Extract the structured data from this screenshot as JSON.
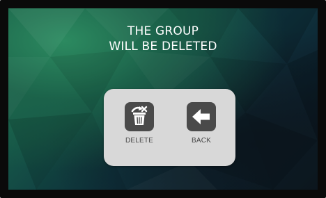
{
  "dialog": {
    "message_line1": "THE GROUP",
    "message_line2": "WILL BE DELETED",
    "actions": [
      {
        "label": "DELETE",
        "icon": "trash-icon"
      },
      {
        "label": "BACK",
        "icon": "arrow-left-icon"
      }
    ]
  },
  "colors": {
    "background_top": "#2c8a60",
    "background_bottom": "#0a141a",
    "panel": "#d8d8d8",
    "tile": "#4a4a4a",
    "label": "#444444",
    "message": "#ffffff"
  }
}
